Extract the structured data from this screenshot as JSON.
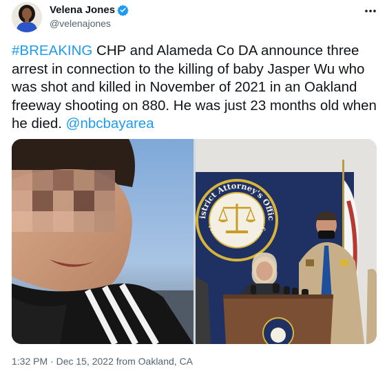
{
  "author": {
    "display_name": "Velena Jones",
    "handle": "@velenajones",
    "verified": true
  },
  "tweet": {
    "hashtag": "#BREAKING",
    "text_main": " CHP and Alameda Co DA announce three arrest in connection to the killing of baby Jasper Wu who was shot and killed in November of 2021 in an Oakland freeway shooting on 880. He was just 23 months old when he died. ",
    "mention": "@nbcbayarea"
  },
  "media": {
    "left_image": "blurred photo of toddler in striped jacket",
    "right_image": "press conference at District Attorney's Office, Alameda County",
    "seal_top_text": "District Attorney's Office",
    "seal_bottom_text": "Alameda County"
  },
  "meta": {
    "timestamp": "1:32 PM · Dec 15, 2022 from Oakland, CA"
  },
  "colors": {
    "link": "#1d9bf0",
    "secondary_text": "#536471",
    "seal_blue": "#1f3163",
    "seal_gold": "#d9b43a"
  },
  "icons": {
    "verified": "verified-badge-icon",
    "more": "more-options-icon"
  }
}
